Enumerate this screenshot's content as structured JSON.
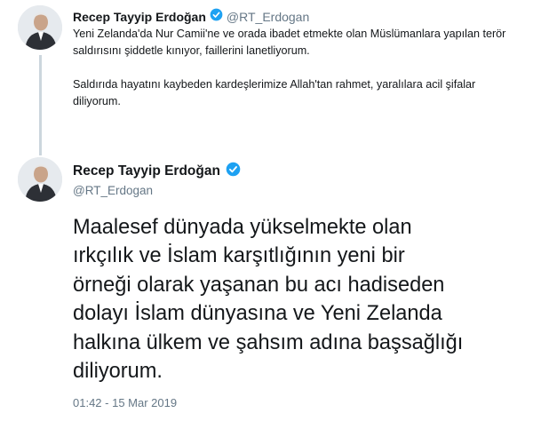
{
  "tweets": [
    {
      "author_name": "Recep Tayyip Erdoğan",
      "handle": "@RT_Erdogan",
      "paragraphs": [
        "Yeni Zelanda'da Nur Camii'ne ve orada ibadet etmekte olan Müslümanlara yapılan terör saldırısını şiddetle kınıyor, faillerini lanetliyorum.",
        "Saldırıda hayatını kaybeden kardeşlerimize Allah'tan rahmet, yaralılara acil şifalar diliyorum."
      ]
    },
    {
      "author_name": "Recep Tayyip Erdoğan",
      "handle": "@RT_Erdogan",
      "text_lines": [
        "Maalesef dünyada yükselmekte olan",
        "ırkçılık ve İslam karşıtlığının yeni bir",
        "örneği olarak yaşanan bu acı hadiseden",
        "dolayı İslam dünyasına ve Yeni Zelanda",
        "halkına ülkem ve şahsım adına başsağlığı",
        "diliyorum."
      ],
      "timestamp": "01:42 - 15 Mar 2019"
    }
  ],
  "colors": {
    "verified_badge": "#1da1f2",
    "thread_line": "#ccd6dd",
    "secondary_text": "#657786"
  },
  "icons": [
    "verified-badge-icon",
    "avatar"
  ]
}
